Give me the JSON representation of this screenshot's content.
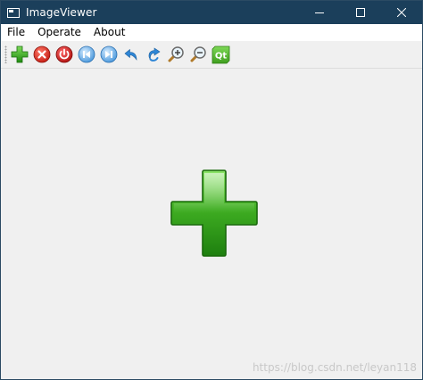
{
  "window": {
    "title": "ImageViewer",
    "controls": [
      "minimize",
      "maximize",
      "close"
    ]
  },
  "menubar": {
    "items": [
      {
        "label": "File"
      },
      {
        "label": "Operate"
      },
      {
        "label": "About"
      }
    ]
  },
  "toolbar": {
    "buttons": [
      {
        "icon": "add-icon"
      },
      {
        "icon": "delete-icon"
      },
      {
        "icon": "clear-icon"
      },
      {
        "icon": "previous-icon"
      },
      {
        "icon": "next-icon"
      },
      {
        "icon": "rotate-left-icon"
      },
      {
        "icon": "rotate-right-icon"
      },
      {
        "icon": "zoom-in-icon"
      },
      {
        "icon": "zoom-out-icon"
      },
      {
        "icon": "qt-icon",
        "label": "Qt"
      }
    ]
  },
  "content": {
    "image": "green-plus-icon"
  },
  "watermark": "https://blog.csdn.net/leyan118",
  "colors": {
    "titlebar": "#1b3f5b",
    "background": "#f0f0f0",
    "plus_green": "#2f9e1f"
  }
}
